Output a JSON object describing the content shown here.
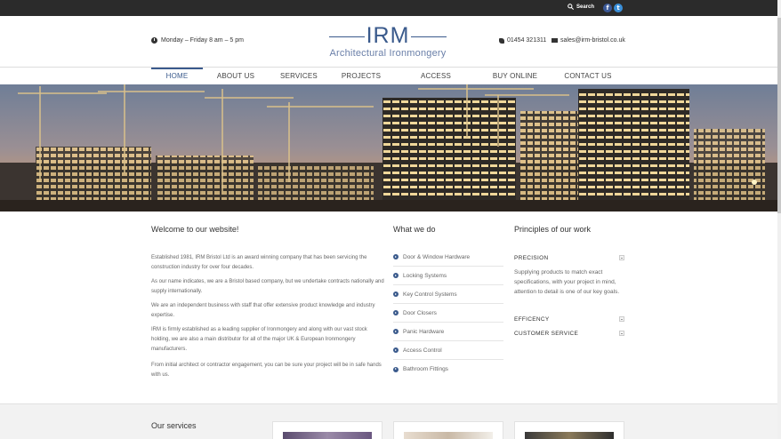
{
  "topbar": {
    "search_label": "Search",
    "social": [
      "facebook-icon",
      "twitter-icon"
    ]
  },
  "header": {
    "hours": "Monday – Friday 8 am – 5 pm",
    "logo_mark": "IRM",
    "logo_sub": "Architectural Ironmongery",
    "phone": "01454 321311",
    "email": "sales@irm-bristol.co.uk"
  },
  "nav": {
    "items": [
      "HOME",
      "ABOUT US",
      "SERVICES",
      "PROJECTS",
      "ACCESS CONTROL",
      "BUY ONLINE",
      "CONTACT US"
    ],
    "active": "HOME"
  },
  "welcome": {
    "title": "Welcome to our website!",
    "paragraphs": [
      "Established 1981, IRM Bristol Ltd is an award winning company that has been servicing the construction industry for over four decades.",
      "As our name indicates, we are a Bristol based company, but we undertake contracts nationally and supply internationally.",
      "We are an independent business with staff that offer extensive product knowledge and industry expertise.",
      "IRM is firmly established as a leading supplier of Ironmongery and along with our vast stock holding, we are also a main distributor for all of the major UK & European Ironmongery manufacturers.",
      "From initial architect or contractor engagement, you can be sure your project will be in safe hands with us."
    ]
  },
  "what_we_do": {
    "title": "What we do",
    "items": [
      "Door & Window Hardware",
      "Locking Systems",
      "Key Control Systems",
      "Door Closers",
      "Panic Hardware",
      "Access Control",
      "Bathroom Fittings"
    ]
  },
  "principles": {
    "title": "Principles of our work",
    "items": [
      {
        "label": "PRECISION",
        "body": "Supplying products to match exact specifications, with your project in mind, attention to detail is one of our key goals."
      },
      {
        "label": "EFFICENCY",
        "body": ""
      },
      {
        "label": "CUSTOMER SERVICE",
        "body": ""
      }
    ]
  },
  "services": {
    "title": "Our services"
  },
  "colors": {
    "brand": "#3a5a8c",
    "topbar": "#2b2b2b"
  }
}
